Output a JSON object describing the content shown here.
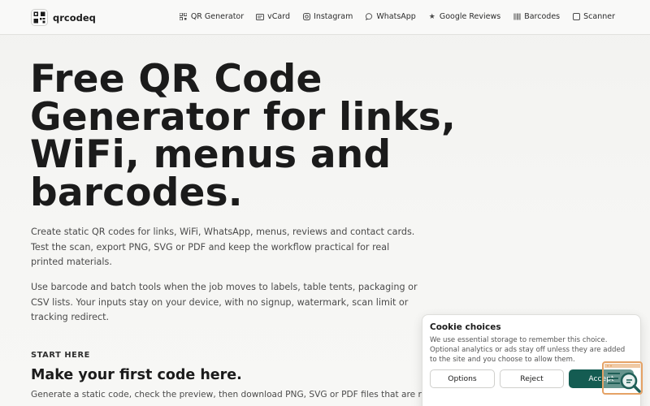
{
  "brand": {
    "name": "qrcodeq"
  },
  "nav": {
    "items": [
      {
        "label": "QR Generator",
        "icon": "qr-grid-icon"
      },
      {
        "label": "vCard",
        "icon": "id-card-icon"
      },
      {
        "label": "Instagram",
        "icon": "instagram-icon"
      },
      {
        "label": "WhatsApp",
        "icon": "chat-bubble-icon"
      },
      {
        "label": "Google Reviews",
        "icon": "star-icon"
      },
      {
        "label": "Barcodes",
        "icon": "barcode-icon"
      },
      {
        "label": "Scanner",
        "icon": "scanner-frame-icon"
      }
    ]
  },
  "hero": {
    "title": "Free QR Code Generator for links, WiFi, menus and barcodes.",
    "lead1": "Create static QR codes for links, WiFi, WhatsApp, menus, reviews and contact cards. Test the scan, export PNG, SVG or PDF and keep the workflow practical for real printed materials.",
    "lead2": "Use barcode and batch tools when the job moves to labels, table tents, packaging or CSV lists. Your inputs stay on your device, with no signup, watermark, scan limit or tracking redirect."
  },
  "start": {
    "eyebrow": "START HERE",
    "title": "Make your first code here.",
    "desc": "Generate a static code, check the preview, then download PNG, SVG or PDF files that are ready for print."
  },
  "cookie": {
    "title": "Cookie choices",
    "text": "We use essential storage to remember this choice. Optional analytics or ads stay off unless they are added to the site and you choose to allow them.",
    "options_label": "Options",
    "reject_label": "Reject",
    "accept_label": "Accept"
  },
  "colors": {
    "accent": "#145c52",
    "background": "#f4f4f2",
    "text": "#1b1b1b",
    "float_border": "#e5a265"
  }
}
